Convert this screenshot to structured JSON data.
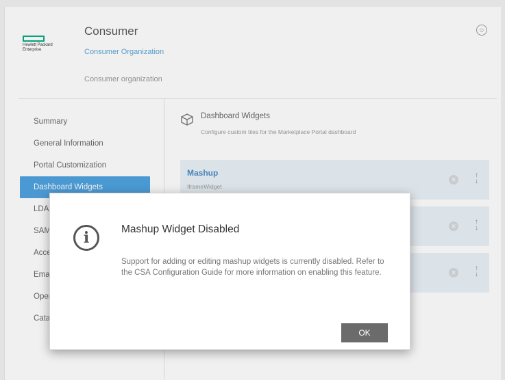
{
  "header": {
    "logo_text": "Hewlett Packard Enterprise",
    "title": "Consumer",
    "org_link": "Consumer Organization",
    "org_description": "Consumer organization"
  },
  "sidebar": {
    "items": [
      {
        "label": "Summary"
      },
      {
        "label": "General Information"
      },
      {
        "label": "Portal Customization"
      },
      {
        "label": "Dashboard Widgets",
        "active": true
      },
      {
        "label": "LDAP"
      },
      {
        "label": "SAML"
      },
      {
        "label": "Access"
      },
      {
        "label": "Email"
      },
      {
        "label": "Operations"
      },
      {
        "label": "Catalogs"
      }
    ]
  },
  "section": {
    "title": "Dashboard Widgets",
    "subtitle": "Configure custom tiles for the Marketplace Portal dashboard"
  },
  "widgets": [
    {
      "name": "Mashup",
      "type": "IframeWidget"
    },
    {
      "name": "",
      "type": ""
    },
    {
      "name": "",
      "type": ""
    }
  ],
  "dialog": {
    "title": "Mashup Widget Disabled",
    "body": "Support for adding or editing mashup widgets is currently disabled. Refer to the CSA Configuration Guide for more information on enabling this feature.",
    "ok_label": "OK"
  },
  "icons": {
    "info": "info-icon",
    "user": "user-icon",
    "box": "box-icon",
    "remove": "remove-icon",
    "reorder": "reorder-arrows-icon"
  },
  "colors": {
    "accent": "#4da1e0",
    "link": "#5aa3d8",
    "brand": "#01a982",
    "ok_button": "#6b6b6b"
  }
}
